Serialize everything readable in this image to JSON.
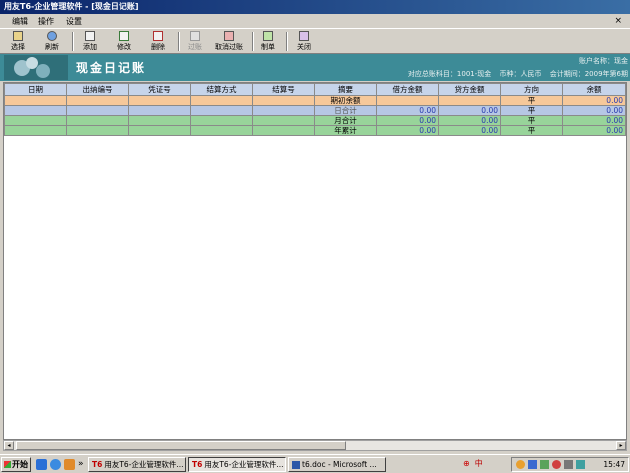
{
  "window": {
    "title": "用友T6-企业管理软件 - [现金日记账]"
  },
  "menubar": {
    "items": [
      "编辑",
      "操作",
      "设置"
    ],
    "close_glyph": "×"
  },
  "toolbar": {
    "buttons": [
      {
        "label": "选择",
        "icon": "select-icon",
        "enabled": true
      },
      {
        "label": "刷新",
        "icon": "refresh-icon",
        "enabled": true
      },
      {
        "label": "添加",
        "icon": "add-icon",
        "enabled": true
      },
      {
        "label": "修改",
        "icon": "edit-icon",
        "enabled": true
      },
      {
        "label": "删除",
        "icon": "delete-icon",
        "enabled": true
      },
      {
        "label": "过账",
        "icon": "post-icon",
        "enabled": false
      },
      {
        "label": "取消过账",
        "icon": "cancel-post-icon",
        "enabled": true
      },
      {
        "label": "制单",
        "icon": "make-voucher-icon",
        "enabled": true
      },
      {
        "label": "关闭",
        "icon": "close-icon",
        "enabled": true
      }
    ]
  },
  "header": {
    "page_title": "现金日记账",
    "account_name": "账户名称：现金",
    "subject": "对应总账科目：1001-现金",
    "currency": "币种：人民币",
    "period": "会计期间：2009年第6期"
  },
  "table": {
    "columns": [
      "日期",
      "出纳编号",
      "凭证号",
      "结算方式",
      "结算号",
      "摘要",
      "借方金额",
      "贷方金额",
      "方向",
      "余额"
    ],
    "rows": [
      {
        "style": "open",
        "cells": [
          "",
          "",
          "",
          "",
          "",
          "期初余额",
          "",
          "",
          "平",
          "0.00"
        ]
      },
      {
        "style": "current",
        "cells": [
          "",
          "",
          "",
          "",
          "",
          "日合计",
          "0.00",
          "0.00",
          "平",
          "0.00"
        ]
      },
      {
        "style": "green",
        "cells": [
          "",
          "",
          "",
          "",
          "",
          "月合计",
          "0.00",
          "0.00",
          "平",
          "0.00"
        ]
      },
      {
        "style": "green",
        "cells": [
          "",
          "",
          "",
          "",
          "",
          "年累计",
          "0.00",
          "0.00",
          "平",
          "0.00"
        ]
      }
    ]
  },
  "taskbar": {
    "start_label": "开始",
    "chevron": "»",
    "tasks": [
      {
        "label": "用友T6-企业管理软件...",
        "badge": "T6",
        "active": false
      },
      {
        "label": "用友T6-企业管理软件...",
        "badge": "T6",
        "active": true
      },
      {
        "label": "t6.doc - Microsoft ...",
        "badge": "",
        "active": false
      }
    ],
    "ime_chars": "中",
    "clock": "15:47"
  },
  "colors": {
    "title_bar": "#0a246a",
    "header_band": "#3d8b97",
    "row_open": "#f6c89a",
    "row_current": "#b6c7e4",
    "row_total": "#98d49a",
    "amount_text": "#2a3bb0"
  }
}
